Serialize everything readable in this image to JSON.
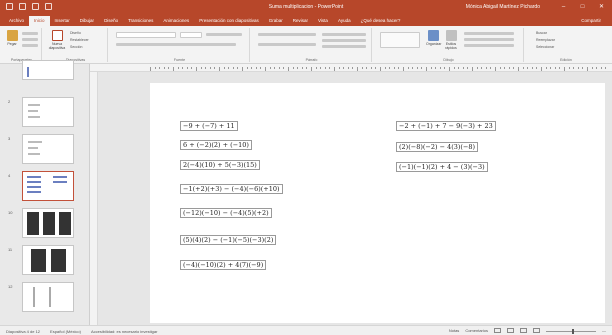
{
  "window": {
    "title": "Suma multiplicacion - PowerPoint",
    "user": "Mónica Abigail Martínez Pichardo",
    "minimize": "–",
    "maximize": "□",
    "close": "✕"
  },
  "tabs": [
    "Archivo",
    "Inicio",
    "Insertar",
    "Dibujar",
    "Diseño",
    "Transiciones",
    "Animaciones",
    "Presentación con diapositivas",
    "Grabar",
    "Revisar",
    "Vista",
    "Ayuda",
    "¿Qué desea hacer?"
  ],
  "share": "Compartir",
  "ribbon": {
    "paste": "Pegar",
    "clipboard": "Portapapeles",
    "new_slide": "Nueva diapositiva",
    "slides_group": "Diapositivas",
    "font_group": "Fuente",
    "paragraph_group": "Párrafo",
    "drawing_group": "Dibujo",
    "editing_group": "Edición",
    "find": "Buscar",
    "replace": "Reemplazar",
    "select": "Seleccionar",
    "layout": "Diseño",
    "reset": "Restablecer",
    "section": "Sección",
    "arrange": "Organizar",
    "quick_styles": "Estilos rápidos"
  },
  "thumbnails": [
    {
      "num": "",
      "selected": false
    },
    {
      "num": "2",
      "selected": false
    },
    {
      "num": "3",
      "selected": false
    },
    {
      "num": "4",
      "selected": true
    },
    {
      "num": "10",
      "selected": false
    },
    {
      "num": "11",
      "selected": false
    },
    {
      "num": "12",
      "selected": false
    }
  ],
  "slide": {
    "expressions_left": [
      "−9 + (−7) + 11",
      "6 + (−2)(2) + (−10)",
      "2(−4)(10) + 5(−3)(15)",
      "−1(+2)(+3) − (−4)(−6)(+10)",
      "(−12)(−10) − (−4)(5)(+2)",
      "(5)(4)(2) − (−1)(−5)(−3)(2)",
      "(−4)(−10)(2) + 4(7)(−9)"
    ],
    "expressions_right": [
      "−2 + (−1) + 7 − 9(−3) + 23",
      "(2)(−8)(−2) − 4(3)(−8)",
      "(−1)(−1)(2) + 4 − (3)(−3)"
    ]
  },
  "status": {
    "slide_info": "Diapositiva 4 de 12",
    "language": "Español (México)",
    "accessibility": "Accesibilidad: es necesario investigar",
    "notes": "Notas",
    "comments": "Comentarios",
    "zoom": "—"
  }
}
